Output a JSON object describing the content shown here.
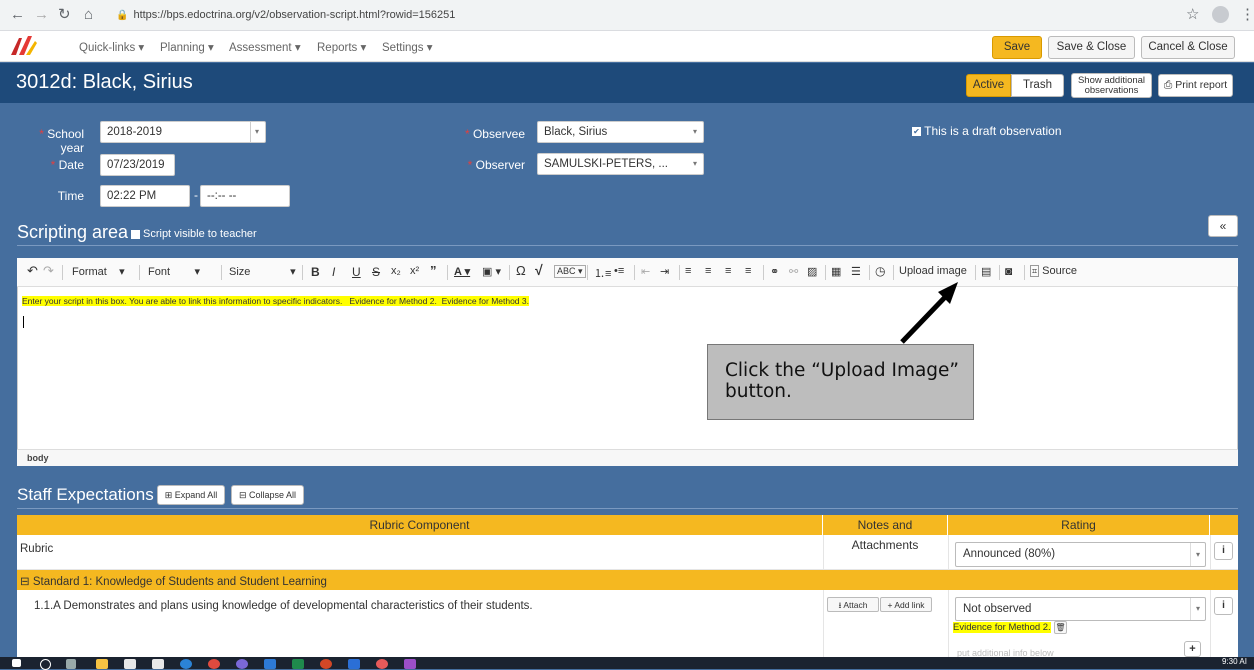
{
  "browser": {
    "url": "https://bps.edoctrina.org/v2/observation-script.html?rowid=156251"
  },
  "nav": {
    "menus": [
      "Quick-links",
      "Planning",
      "Assessment",
      "Reports",
      "Settings"
    ],
    "save_label": "Save",
    "save_close_label": "Save & Close",
    "cancel_close_label": "Cancel & Close"
  },
  "header": {
    "title": "3012d: Black, Sirius",
    "active_label": "Active",
    "trash_label": "Trash",
    "show_additional_line1": "Show additional",
    "show_additional_line2": "observations",
    "print_label": "Print report"
  },
  "form": {
    "school_year_label": "School year",
    "school_year_value": "2018-2019",
    "date_label": "Date",
    "date_value": "07/23/2019",
    "time_label": "Time",
    "time_start": "02:22 PM",
    "time_end": "--:-- --",
    "observee_label": "Observee",
    "observee_value": "Black, Sirius",
    "observer_label": "Observer",
    "observer_value": "SAMULSKI-PETERS, ...",
    "draft_label": "This is a draft observation"
  },
  "scripting": {
    "title": "Scripting area",
    "visible_label": "Script visible to teacher",
    "collapse_glyph": "«",
    "toolbar": {
      "format": "Format",
      "font": "Font",
      "size": "Size",
      "upload_image": "Upload image",
      "source": "Source"
    },
    "hint_text": "Enter your script in this box.  You are able to link this information to specific indicators.",
    "evidence_2": "Evidence for Method 2.",
    "evidence_3": "Evidence for Method 3.",
    "status": "body"
  },
  "callout": {
    "text": "Click the “Upload Image” button."
  },
  "expectations": {
    "title": "Staff Expectations",
    "expand_label": "Expand All",
    "collapse_label": "Collapse All",
    "columns": [
      "Rubric Component",
      "Notes and Attachments",
      "Rating"
    ],
    "rubric_label": "Rubric",
    "rubric_value": "Announced (80%)",
    "standard_label": "Standard 1: Knowledge of Students and Student Learning",
    "indicator_label": "1.1.A Demonstrates and plans using knowledge of developmental characteristics of their students.",
    "attach_label": "Attach",
    "add_link_label": "Add link",
    "indicator_rating": "Not observed",
    "indicator_evidence": "Evidence for Method 2.",
    "info_placeholder": "put additional info below"
  },
  "taskbar": {
    "clock": "9:30 AI"
  },
  "colors": {
    "brand_blue": "#1e4a7a",
    "page_blue": "#456e9e",
    "accent_yellow": "#f5b820",
    "highlight": "#ffff00"
  }
}
